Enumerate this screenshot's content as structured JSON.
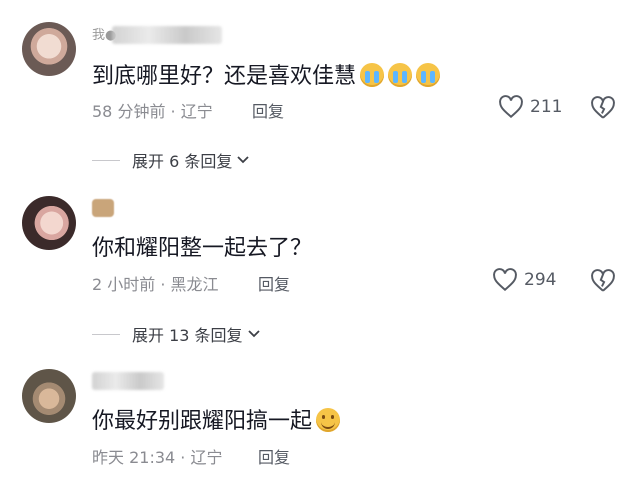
{
  "comments": [
    {
      "text": "到底哪里好？还是喜欢佳慧",
      "emoji": [
        "loudly-crying-face-icon",
        "loudly-crying-face-icon",
        "loudly-crying-face-icon"
      ],
      "meta": "58 分钟前 · 辽宁",
      "reply_label": "回复",
      "likes": "211",
      "expand_label": "展开 6 条回复"
    },
    {
      "text": "你和耀阳整一起去了？",
      "meta": "2 小时前 · 黑龙江",
      "reply_label": "回复",
      "likes": "294",
      "expand_label": "展开 13 条回复"
    },
    {
      "text": "你最好别跟耀阳搞一起",
      "emoji": [
        "smiling-face-icon"
      ],
      "meta": "昨天 21:34 · 辽宁",
      "reply_label": "回复"
    }
  ],
  "colors": {
    "text": "#161823",
    "meta": "#8a8b91",
    "like": "#555a63"
  }
}
